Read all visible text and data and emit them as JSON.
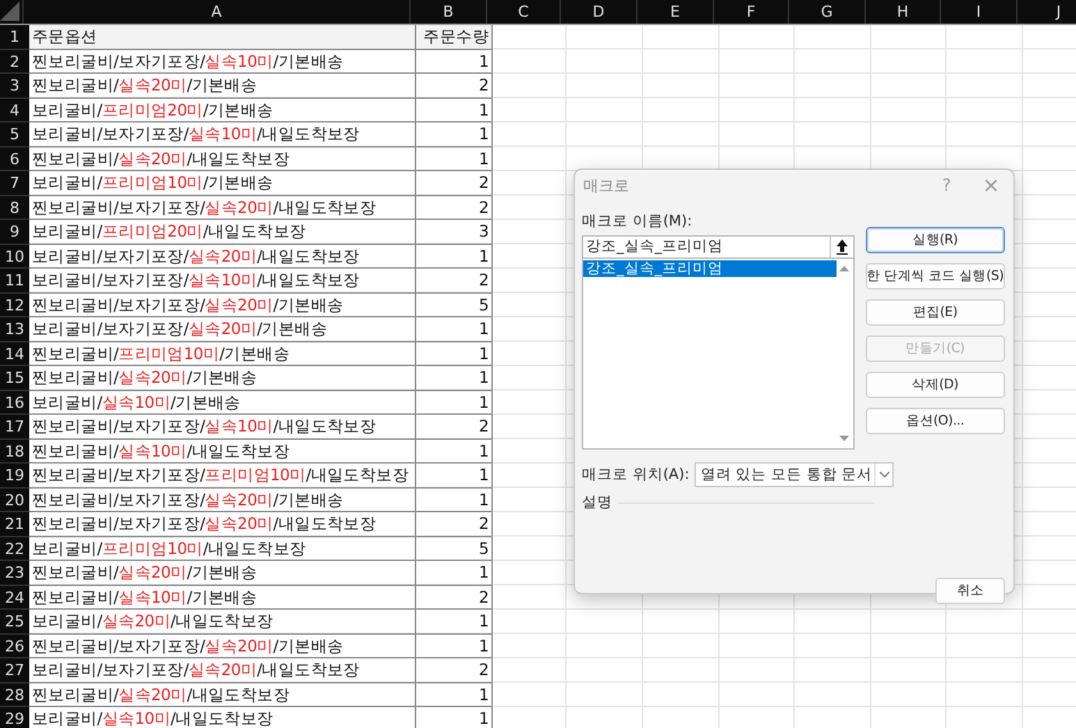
{
  "sheet": {
    "columns": [
      "A",
      "B",
      "C",
      "D",
      "E",
      "F",
      "G",
      "H",
      "I",
      "J"
    ],
    "header_row": {
      "num": "1",
      "option": "주문옵션",
      "qty": "주문수량"
    },
    "rows": [
      {
        "num": "2",
        "prefix": "찐보리굴비/보자기포장/",
        "highlight": "실속10미",
        "suffix": "/기본배송",
        "qty": "1"
      },
      {
        "num": "3",
        "prefix": "찐보리굴비/",
        "highlight": "실속20미",
        "suffix": "/기본배송",
        "qty": "2"
      },
      {
        "num": "4",
        "prefix": "보리굴비/",
        "highlight": "프리미엄20미",
        "suffix": "/기본배송",
        "qty": "1"
      },
      {
        "num": "5",
        "prefix": "보리굴비/보자기포장/",
        "highlight": "실속10미",
        "suffix": "/내일도착보장",
        "qty": "1"
      },
      {
        "num": "6",
        "prefix": "찐보리굴비/",
        "highlight": "실속20미",
        "suffix": "/내일도착보장",
        "qty": "1"
      },
      {
        "num": "7",
        "prefix": "보리굴비/",
        "highlight": "프리미엄10미",
        "suffix": "/기본배송",
        "qty": "2"
      },
      {
        "num": "8",
        "prefix": "찐보리굴비/보자기포장/",
        "highlight": "실속20미",
        "suffix": "/내일도착보장",
        "qty": "2"
      },
      {
        "num": "9",
        "prefix": "보리굴비/",
        "highlight": "프리미엄20미",
        "suffix": "/내일도착보장",
        "qty": "3"
      },
      {
        "num": "10",
        "prefix": "보리굴비/보자기포장/",
        "highlight": "실속20미",
        "suffix": "/내일도착보장",
        "qty": "1"
      },
      {
        "num": "11",
        "prefix": "보리굴비/보자기포장/",
        "highlight": "실속10미",
        "suffix": "/내일도착보장",
        "qty": "2"
      },
      {
        "num": "12",
        "prefix": "찐보리굴비/보자기포장/",
        "highlight": "실속20미",
        "suffix": "/기본배송",
        "qty": "5"
      },
      {
        "num": "13",
        "prefix": "보리굴비/보자기포장/",
        "highlight": "실속20미",
        "suffix": "/기본배송",
        "qty": "1"
      },
      {
        "num": "14",
        "prefix": "찐보리굴비/",
        "highlight": "프리미엄10미",
        "suffix": "/기본배송",
        "qty": "1"
      },
      {
        "num": "15",
        "prefix": "찐보리굴비/",
        "highlight": "실속20미",
        "suffix": "/기본배송",
        "qty": "1"
      },
      {
        "num": "16",
        "prefix": "보리굴비/",
        "highlight": "실속10미",
        "suffix": "/기본배송",
        "qty": "1"
      },
      {
        "num": "17",
        "prefix": "찐보리굴비/보자기포장/",
        "highlight": "실속10미",
        "suffix": "/내일도착보장",
        "qty": "2"
      },
      {
        "num": "18",
        "prefix": "찐보리굴비/",
        "highlight": "실속10미",
        "suffix": "/내일도착보장",
        "qty": "1"
      },
      {
        "num": "19",
        "prefix": "찐보리굴비/보자기포장/",
        "highlight": "프리미엄10미",
        "suffix": "/내일도착보장",
        "qty": "1"
      },
      {
        "num": "20",
        "prefix": "찐보리굴비/보자기포장/",
        "highlight": "실속20미",
        "suffix": "/기본배송",
        "qty": "1"
      },
      {
        "num": "21",
        "prefix": "찐보리굴비/보자기포장/",
        "highlight": "실속20미",
        "suffix": "/내일도착보장",
        "qty": "2"
      },
      {
        "num": "22",
        "prefix": "보리굴비/",
        "highlight": "프리미엄10미",
        "suffix": "/내일도착보장",
        "qty": "5"
      },
      {
        "num": "23",
        "prefix": "찐보리굴비/",
        "highlight": "실속20미",
        "suffix": "/기본배송",
        "qty": "1"
      },
      {
        "num": "24",
        "prefix": "찐보리굴비/",
        "highlight": "실속10미",
        "suffix": "/기본배송",
        "qty": "2"
      },
      {
        "num": "25",
        "prefix": "보리굴비/",
        "highlight": "실속20미",
        "suffix": "/내일도착보장",
        "qty": "1"
      },
      {
        "num": "26",
        "prefix": "찐보리굴비/보자기포장/",
        "highlight": "실속20미",
        "suffix": "/기본배송",
        "qty": "1"
      },
      {
        "num": "27",
        "prefix": "보리굴비/보자기포장/",
        "highlight": "실속20미",
        "suffix": "/내일도착보장",
        "qty": "2"
      },
      {
        "num": "28",
        "prefix": "찐보리굴비/",
        "highlight": "실속20미",
        "suffix": "/내일도착보장",
        "qty": "1"
      },
      {
        "num": "29",
        "prefix": "보리굴비/",
        "highlight": "실속10미",
        "suffix": "/내일도착보장",
        "qty": "1"
      }
    ]
  },
  "dialog": {
    "title": "매크로",
    "help": "?",
    "close": "×",
    "name_label": "매크로 이름(M):",
    "name_value": "강조_실속_프리미엄",
    "macros": [
      {
        "label": "강조_실속_프리미엄",
        "selected": true
      }
    ],
    "buttons": [
      {
        "label": "실행(R)",
        "default": true,
        "disabled": false
      },
      {
        "label": "한 단계씩 코드 실행(S)",
        "default": false,
        "disabled": false
      },
      {
        "label": "편집(E)",
        "default": false,
        "disabled": false
      },
      {
        "label": "만들기(C)",
        "default": false,
        "disabled": true
      },
      {
        "label": "삭제(D)",
        "default": false,
        "disabled": false
      },
      {
        "label": "옵션(O)...",
        "default": false,
        "disabled": false
      }
    ],
    "location_label": "매크로 위치(A):",
    "location_value": "열려 있는 모든 통합 문서",
    "description_label": "설명",
    "cancel": "취소"
  }
}
